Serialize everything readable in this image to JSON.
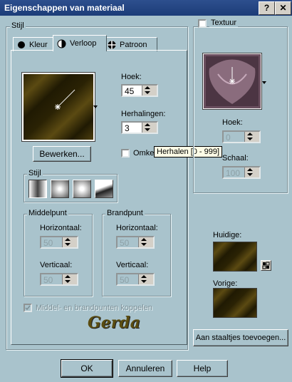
{
  "window": {
    "title": "Eigenschappen van materiaal",
    "help_btn": "?",
    "close_btn": "✕"
  },
  "stijl_group": "Stijl",
  "tabs": [
    {
      "label": "Kleur",
      "icon": "dot-icon"
    },
    {
      "label": "Verloop",
      "icon": "half-circle-icon"
    },
    {
      "label": "Patroon",
      "icon": "grid-icon"
    }
  ],
  "gradient": {
    "hoek_label": "Hoek:",
    "hoek_value": "45",
    "herhalingen_label": "Herhalingen:",
    "herhalingen_value": "3",
    "bewerken_label": "Bewerken...",
    "omkeren_label": "Omke",
    "style_group": "Stijl",
    "style_icons": [
      "linear-gradient-icon",
      "rectangular-gradient-icon",
      "radial-gradient-icon",
      "sunburst-gradient-icon"
    ],
    "middelpunt": {
      "title": "Middelpunt",
      "horizontaal_label": "Horizontaal:",
      "horizontaal_value": "50",
      "verticaal_label": "Verticaal:",
      "verticaal_value": "50"
    },
    "brandpunt": {
      "title": "Brandpunt",
      "horizontaal_label": "Horizontaal:",
      "horizontaal_value": "50",
      "verticaal_label": "Verticaal:",
      "verticaal_value": "50"
    },
    "koppelen_label": "Middel- en brandpunten koppelen"
  },
  "tooltip": "Herhalen [0 - 999]",
  "signature": "Gerda",
  "texture": {
    "label": "Textuur",
    "hoek_label": "Hoek:",
    "hoek_value": "0",
    "schaal_label": "Schaal:",
    "schaal_value": "100"
  },
  "current": {
    "huidige_label": "Huidige:",
    "vorige_label": "Vorige:"
  },
  "add_swatch_label": "Aan staaltjes toevoegen...",
  "buttons": {
    "ok": "OK",
    "annuleren": "Annuleren",
    "help": "Help"
  },
  "colors": {
    "titlebar": "#1c3c78",
    "dialog_bg": "#a9c3cc",
    "gradient_dark": "#2a2204",
    "gradient_light": "#5b4a12",
    "texture": "#6b4f5f"
  }
}
